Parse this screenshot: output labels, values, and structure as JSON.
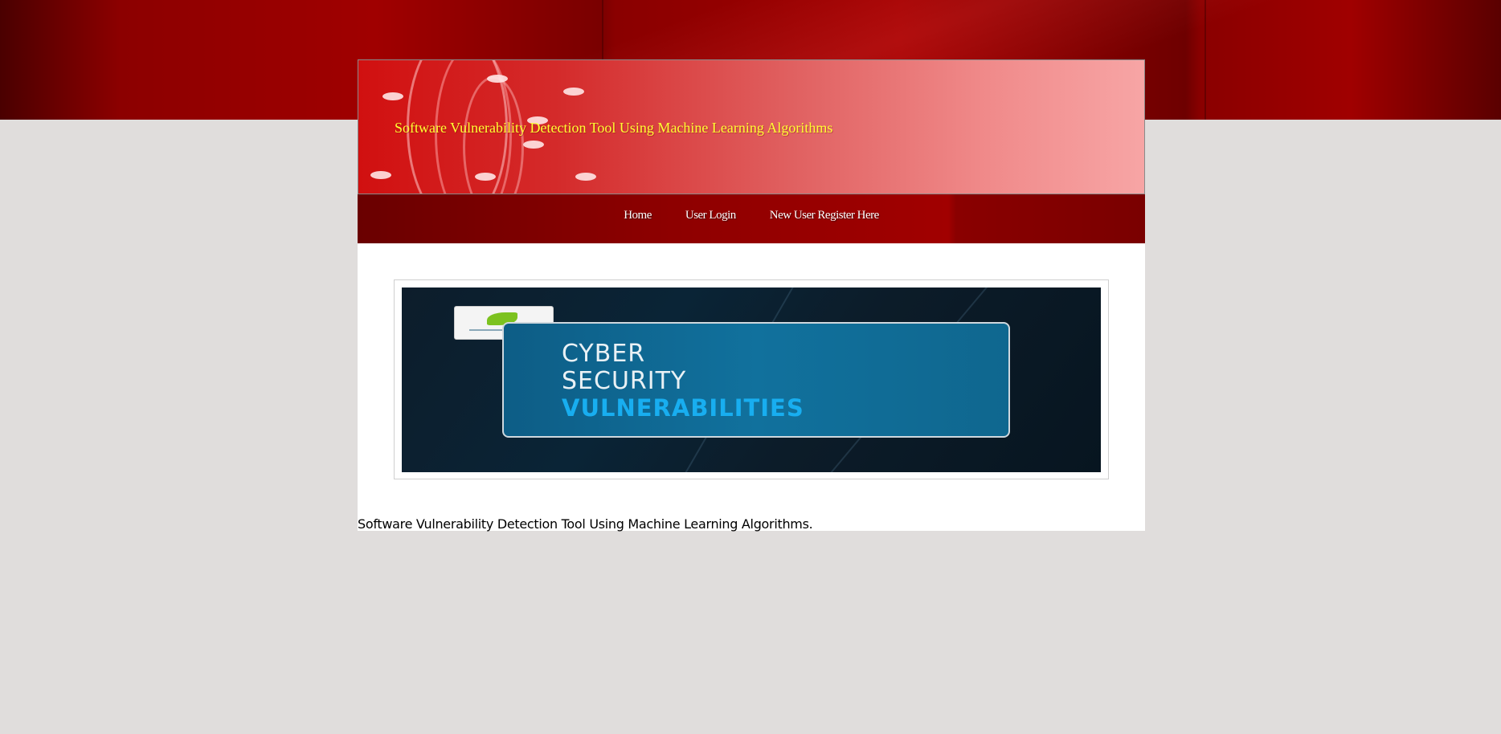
{
  "header": {
    "title": "Software Vulnerability Detection Tool Using Machine Learning Algorithms"
  },
  "nav": {
    "items": [
      {
        "label": "Home"
      },
      {
        "label": "User Login"
      },
      {
        "label": "New User Register Here"
      }
    ]
  },
  "banner": {
    "line1": "CYBER",
    "line2": "SECURITY",
    "line3": "VULNERABILITIES"
  },
  "content": {
    "description": "Software Vulnerability Detection Tool Using Machine Learning Algorithms."
  },
  "colors": {
    "title_yellow": "#ffff33",
    "nav_red": "#8e0000",
    "page_bg": "#e0dddc"
  }
}
